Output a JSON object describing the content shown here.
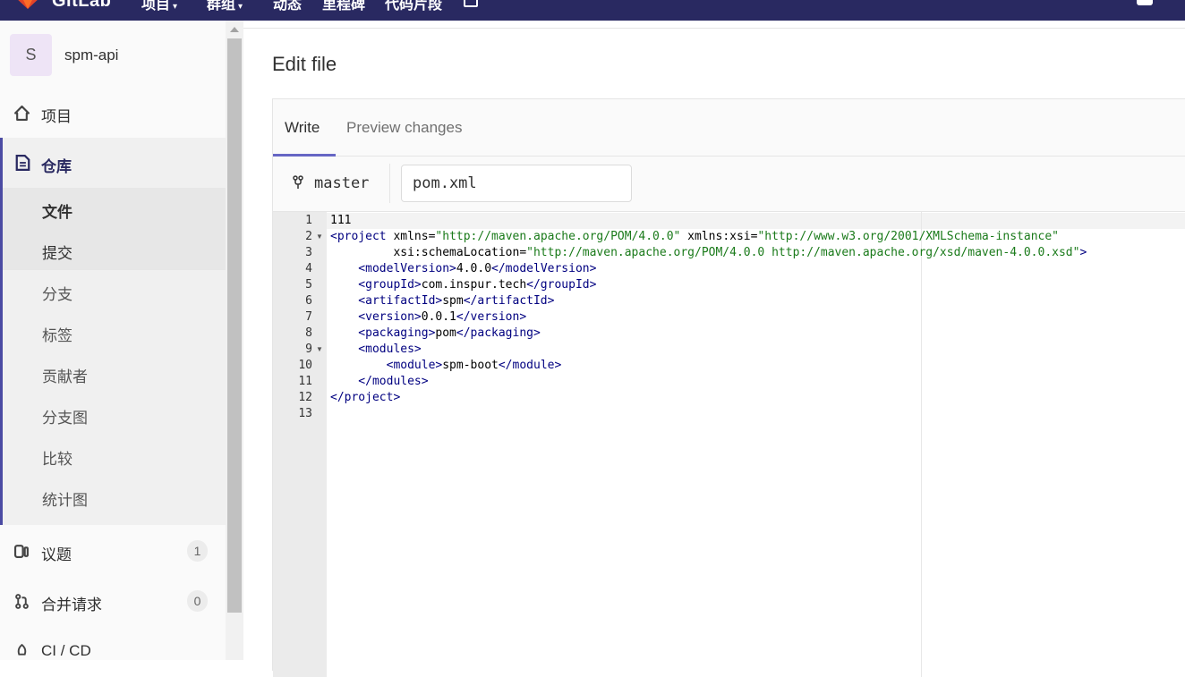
{
  "topbar": {
    "brand": "GitLab",
    "nav": [
      {
        "label": "项目",
        "caret": "▾"
      },
      {
        "label": "群组",
        "caret": "▾"
      },
      {
        "label": "动态",
        "caret": ""
      },
      {
        "label": "里程碑",
        "caret": ""
      },
      {
        "label": "代码片段",
        "caret": ""
      }
    ],
    "colors": {
      "navbar": "#292961",
      "accent": "#6666c4"
    }
  },
  "sidebar": {
    "project": {
      "avatar_letter": "S",
      "name": "spm-api"
    },
    "items_top": [
      {
        "label": "项目",
        "icon": "home-icon"
      }
    ],
    "repository": {
      "title": "仓库",
      "icon": "file-icon",
      "sub_items": [
        {
          "label": "文件"
        },
        {
          "label": "提交"
        },
        {
          "label": "分支"
        },
        {
          "label": "标签"
        },
        {
          "label": "贡献者"
        },
        {
          "label": "分支图"
        },
        {
          "label": "比较"
        },
        {
          "label": "统计图"
        }
      ]
    },
    "items_bottom": [
      {
        "label": "议题",
        "icon": "issues-icon",
        "badge": "1"
      },
      {
        "label": "合并请求",
        "icon": "merge-request-icon",
        "badge": "0"
      },
      {
        "label": "CI / CD",
        "icon": "rocket-icon",
        "badge": ""
      }
    ]
  },
  "main": {
    "title": "Edit file",
    "tabs": {
      "write": "Write",
      "preview": "Preview changes"
    },
    "branch": "master",
    "file_name": "pom.xml",
    "lines": [
      {
        "n": "1",
        "fold": ""
      },
      {
        "n": "2",
        "fold": "▼"
      },
      {
        "n": "3",
        "fold": ""
      },
      {
        "n": "4",
        "fold": ""
      },
      {
        "n": "5",
        "fold": ""
      },
      {
        "n": "6",
        "fold": ""
      },
      {
        "n": "7",
        "fold": ""
      },
      {
        "n": "8",
        "fold": ""
      },
      {
        "n": "9",
        "fold": "▼"
      },
      {
        "n": "10",
        "fold": ""
      },
      {
        "n": "11",
        "fold": ""
      },
      {
        "n": "12",
        "fold": ""
      },
      {
        "n": "13",
        "fold": ""
      }
    ],
    "code": [
      [
        {
          "c": "a",
          "t": "111"
        }
      ],
      [
        {
          "c": "t",
          "t": "<project"
        },
        {
          "c": "a",
          "t": " xmlns="
        },
        {
          "c": "s",
          "t": "\"http://maven.apache.org/POM/4.0.0\""
        },
        {
          "c": "a",
          "t": " xmlns:xsi="
        },
        {
          "c": "s",
          "t": "\"http://www.w3.org/2001/XMLSchema-instance\""
        }
      ],
      [
        {
          "c": "a",
          "t": "         xsi:schemaLocation="
        },
        {
          "c": "s",
          "t": "\"http://maven.apache.org/POM/4.0.0 http://maven.apache.org/xsd/maven-4.0.0.xsd\""
        },
        {
          "c": "t",
          "t": ">"
        }
      ],
      [
        {
          "c": "t",
          "t": "    <modelVersion>"
        },
        {
          "c": "a",
          "t": "4.0.0"
        },
        {
          "c": "t",
          "t": "</modelVersion>"
        }
      ],
      [
        {
          "c": "t",
          "t": "    <groupId>"
        },
        {
          "c": "a",
          "t": "com.inspur.tech"
        },
        {
          "c": "t",
          "t": "</groupId>"
        }
      ],
      [
        {
          "c": "t",
          "t": "    <artifactId>"
        },
        {
          "c": "a",
          "t": "spm"
        },
        {
          "c": "t",
          "t": "</artifactId>"
        }
      ],
      [
        {
          "c": "t",
          "t": "    <version>"
        },
        {
          "c": "a",
          "t": "0.0.1"
        },
        {
          "c": "t",
          "t": "</version>"
        }
      ],
      [
        {
          "c": "t",
          "t": "    <packaging>"
        },
        {
          "c": "a",
          "t": "pom"
        },
        {
          "c": "t",
          "t": "</packaging>"
        }
      ],
      [
        {
          "c": "t",
          "t": "    <modules>"
        }
      ],
      [
        {
          "c": "t",
          "t": "        <module>"
        },
        {
          "c": "a",
          "t": "spm-boot"
        },
        {
          "c": "t",
          "t": "</module>"
        }
      ],
      [
        {
          "c": "t",
          "t": "    </modules>"
        }
      ],
      [
        {
          "c": "t",
          "t": "</project>"
        }
      ],
      []
    ]
  }
}
